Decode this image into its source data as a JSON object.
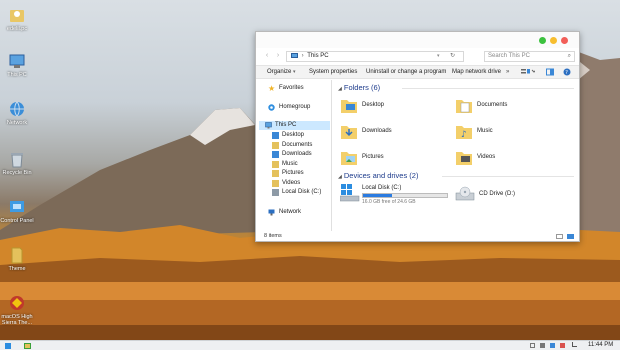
{
  "desktop": {
    "icons": [
      {
        "label": "edelil.pc",
        "icon": "user-folder-icon"
      },
      {
        "label": "This PC",
        "icon": "computer-icon"
      },
      {
        "label": "Network",
        "icon": "network-globe-icon"
      },
      {
        "label": "Recycle Bin",
        "icon": "recycle-bin-icon"
      },
      {
        "label": "Control Panel",
        "icon": "control-panel-icon"
      },
      {
        "label": "Theme",
        "icon": "folder-icon"
      },
      {
        "label": "macOS High Sierra The...",
        "icon": "theme-icon"
      }
    ]
  },
  "window": {
    "address": {
      "location": "This PC",
      "search_placeholder": "Search This PC",
      "separator": "›"
    },
    "toolbar": {
      "items": [
        "Organize",
        "System properties",
        "Uninstall or change a program",
        "Map network drive"
      ],
      "overflow": "»"
    },
    "nav": {
      "favorites": "Favorites",
      "homegroup": "Homegroup",
      "this_pc": "This PC",
      "children": [
        "Desktop",
        "Documents",
        "Downloads",
        "Music",
        "Pictures",
        "Videos",
        "Local Disk (C:)"
      ],
      "network": "Network"
    },
    "folders_header": "Folders (6)",
    "folders": [
      "Desktop",
      "Documents",
      "Downloads",
      "Music",
      "Pictures",
      "Videos"
    ],
    "drives_header": "Devices and drives (2)",
    "drives": [
      {
        "name": "Local Disk (C:)",
        "free": "16.0 GB free of 24.6 GB",
        "used_fraction": 0.35
      },
      {
        "name": "CD Drive (D:)"
      }
    ],
    "status": "8 items"
  },
  "taskbar": {
    "clock": "11:44 PM"
  },
  "colors": {
    "accent": "#0078d7",
    "selected_bg": "#cce8ff",
    "group_header": "#1e3c8c",
    "close": "#f25e58",
    "minimize": "#f7be2f",
    "maximize": "#3cc23f"
  }
}
